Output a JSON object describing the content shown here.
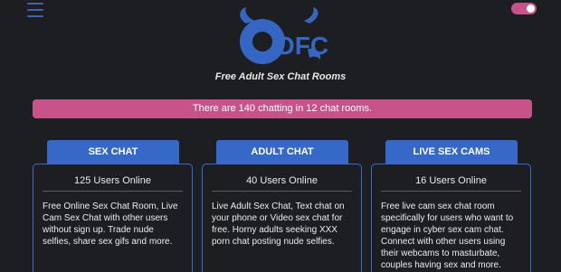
{
  "header": {
    "menu_icon": "hamburger-menu-icon",
    "theme_toggle": "theme-toggle-switch",
    "logo_text": "OFC",
    "tagline": "Free Adult Sex Chat Rooms"
  },
  "banner": {
    "text": "There are 140 chatting in 12 chat rooms."
  },
  "cards": [
    {
      "title": "SEX CHAT",
      "online": "125 Users Online",
      "description": "Free Online Sex Chat Room, Live Cam Sex Chat with other users without sign up. Trade nude selfies, share sex gifs and more."
    },
    {
      "title": "ADULT CHAT",
      "online": "40 Users Online",
      "description": "Live Adult Sex Chat, Text chat on your phone or Video sex chat for free. Horny adults seeking XXX porn chat posting nude selfies."
    },
    {
      "title": "LIVE SEX CAMS",
      "online": "16 Users Online",
      "description": "Free live cam sex chat room specifically for users who want to engage in cyber sex cam chat. Connect with other users using their webcams to masturbate, couples having sex and more."
    }
  ],
  "colors": {
    "background": "#1c1e22",
    "accent_blue": "#3568c7",
    "accent_pink": "#c8538a"
  }
}
